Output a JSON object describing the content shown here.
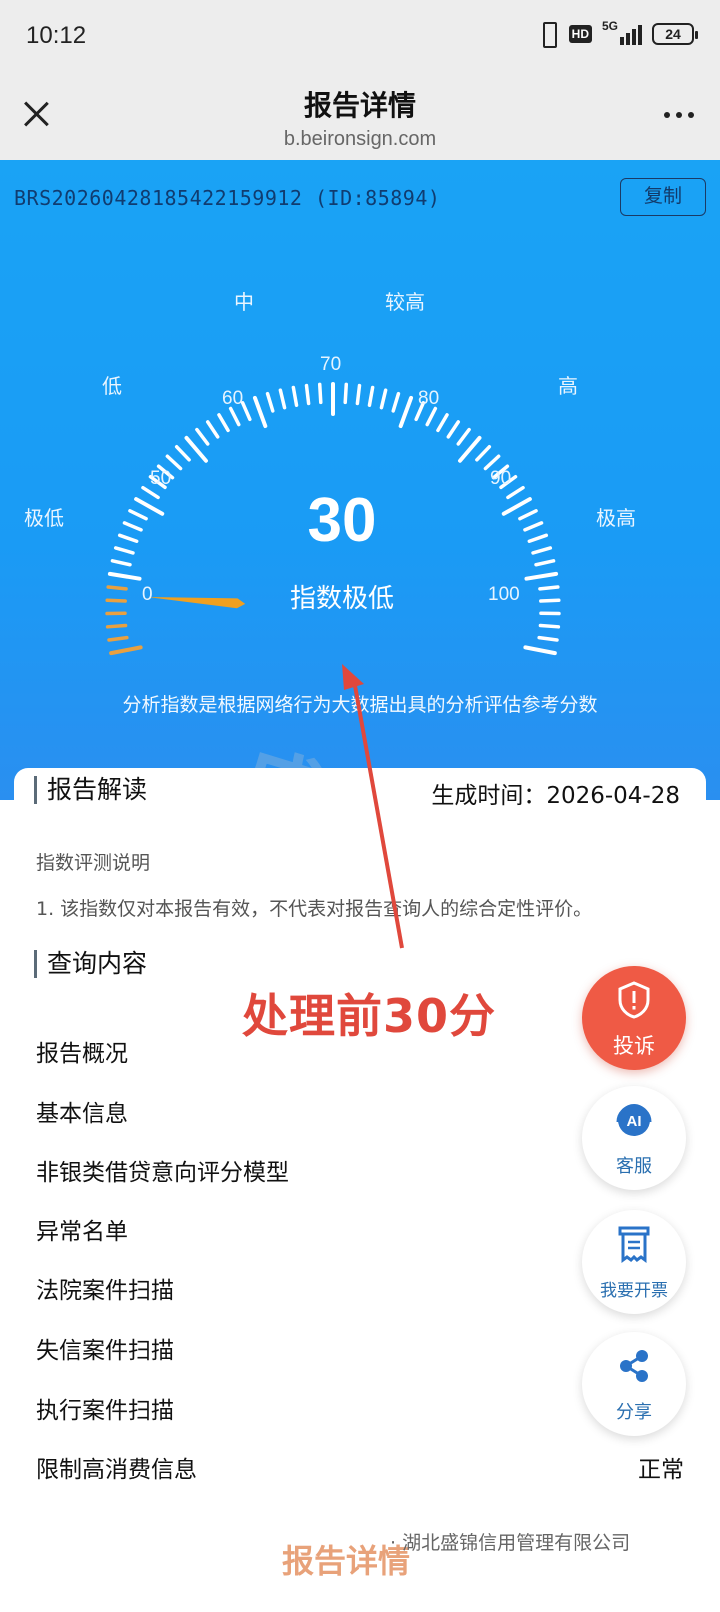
{
  "status": {
    "time": "10:12",
    "battery": "24",
    "network": "5G",
    "hd": "HD"
  },
  "nav": {
    "title": "报告详情",
    "url": "b.beironsign.com"
  },
  "report": {
    "id_text": "BRS20260428185422159912 (ID:85894)",
    "copy_label": "复制",
    "gauge": {
      "level_labels": [
        "极低",
        "低",
        "中",
        "较高",
        "高",
        "极高"
      ],
      "tick_labels": [
        "0",
        "50",
        "60",
        "70",
        "80",
        "90",
        "100"
      ],
      "score": "30",
      "score_value": 30,
      "level_text": "指数极低",
      "needle_color": "#f0a020"
    },
    "note": "分析指数是根据网络行为大数据出具的分析评估参考分数"
  },
  "interpret": {
    "title": "报告解读",
    "gen_time": "生成时间：2026-04-28",
    "explain_title": "指数评测说明",
    "explain_text": "1. 该指数仅对本报告有效，不代表对报告查询人的综合定性评价。"
  },
  "query": {
    "title": "查询内容",
    "items": [
      "报告概况",
      "基本信息",
      "非银类借贷意向评分模型",
      "异常名单",
      "法院案件扫描",
      "失信案件扫描",
      "执行案件扫描",
      "限制高消费信息"
    ],
    "last_value": "正常"
  },
  "annotation": {
    "text": "处理前30分",
    "color": "#e0483c"
  },
  "watermark": "盛锦信用",
  "fabs": {
    "complaint": "投诉",
    "ai_service": "客服",
    "ai_badge": "AI",
    "invoice": "我要开票",
    "share": "分享"
  },
  "footer": {
    "title": "报告详情",
    "source": "· 湖北盛锦信用管理有限公司"
  }
}
